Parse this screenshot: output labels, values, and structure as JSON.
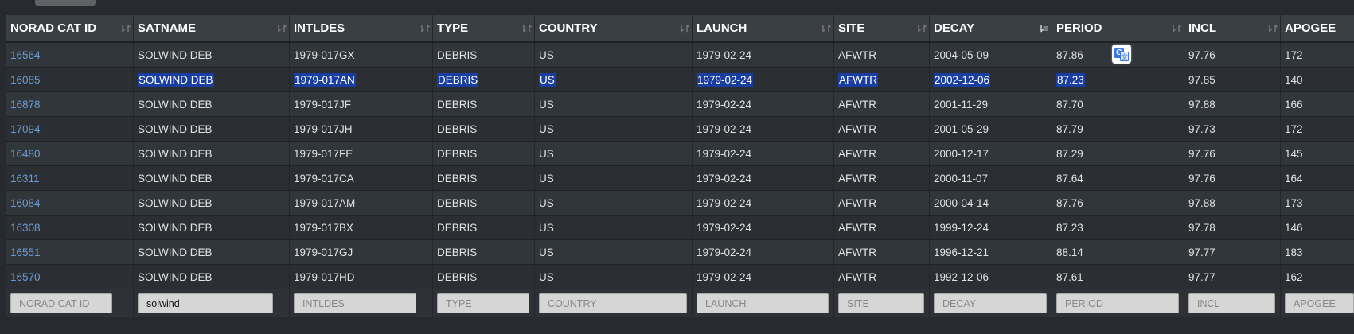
{
  "columns": [
    {
      "label": "NORAD CAT ID",
      "placeholder": "NORAD CAT ID"
    },
    {
      "label": "SATNAME",
      "placeholder": "SATNAME"
    },
    {
      "label": "INTLDES",
      "placeholder": "INTLDES"
    },
    {
      "label": "TYPE",
      "placeholder": "TYPE"
    },
    {
      "label": "COUNTRY",
      "placeholder": "COUNTRY"
    },
    {
      "label": "LAUNCH",
      "placeholder": "LAUNCH"
    },
    {
      "label": "SITE",
      "placeholder": "SITE"
    },
    {
      "label": "DECAY",
      "placeholder": "DECAY"
    },
    {
      "label": "PERIOD",
      "placeholder": "PERIOD"
    },
    {
      "label": "INCL",
      "placeholder": "INCL"
    },
    {
      "label": "APOGEE",
      "placeholder": "APOGEE"
    }
  ],
  "sort": {
    "column": "DECAY",
    "direction": "descending"
  },
  "filters": {
    "satname_value": "solwind"
  },
  "rows": [
    [
      "16564",
      "SOLWIND DEB",
      "1979-017GX",
      "DEBRIS",
      "US",
      "1979-02-24",
      "AFWTR",
      "2004-05-09",
      "87.86",
      "97.76",
      "172"
    ],
    [
      "16085",
      "SOLWIND DEB",
      "1979-017AN",
      "DEBRIS",
      "US",
      "1979-02-24",
      "AFWTR",
      "2002-12-06",
      "87.23",
      "97.85",
      "140"
    ],
    [
      "16878",
      "SOLWIND DEB",
      "1979-017JF",
      "DEBRIS",
      "US",
      "1979-02-24",
      "AFWTR",
      "2001-11-29",
      "87.70",
      "97.88",
      "166"
    ],
    [
      "17094",
      "SOLWIND DEB",
      "1979-017JH",
      "DEBRIS",
      "US",
      "1979-02-24",
      "AFWTR",
      "2001-05-29",
      "87.79",
      "97.73",
      "172"
    ],
    [
      "16480",
      "SOLWIND DEB",
      "1979-017FE",
      "DEBRIS",
      "US",
      "1979-02-24",
      "AFWTR",
      "2000-12-17",
      "87.29",
      "97.76",
      "145"
    ],
    [
      "16311",
      "SOLWIND DEB",
      "1979-017CA",
      "DEBRIS",
      "US",
      "1979-02-24",
      "AFWTR",
      "2000-11-07",
      "87.64",
      "97.76",
      "164"
    ],
    [
      "16084",
      "SOLWIND DEB",
      "1979-017AM",
      "DEBRIS",
      "US",
      "1979-02-24",
      "AFWTR",
      "2000-04-14",
      "87.76",
      "97.88",
      "173"
    ],
    [
      "16308",
      "SOLWIND DEB",
      "1979-017BX",
      "DEBRIS",
      "US",
      "1979-02-24",
      "AFWTR",
      "1999-12-24",
      "87.23",
      "97.78",
      "146"
    ],
    [
      "16551",
      "SOLWIND DEB",
      "1979-017GJ",
      "DEBRIS",
      "US",
      "1979-02-24",
      "AFWTR",
      "1996-12-21",
      "88.14",
      "97.77",
      "183"
    ],
    [
      "16570",
      "SOLWIND DEB",
      "1979-017HD",
      "DEBRIS",
      "US",
      "1979-02-24",
      "AFWTR",
      "1992-12-06",
      "87.61",
      "97.77",
      "162"
    ]
  ],
  "selection": {
    "row_index": 1,
    "columns_selected": [
      1,
      2,
      3,
      4,
      5,
      6,
      7,
      8
    ]
  },
  "colors": {
    "background": "#272b30",
    "header": "#3a3f44",
    "link": "#6b9bd6",
    "selection": "#1a3ea0"
  },
  "icons": {
    "sort": "sort-arrows-icon",
    "translate": "google-translate-icon"
  }
}
